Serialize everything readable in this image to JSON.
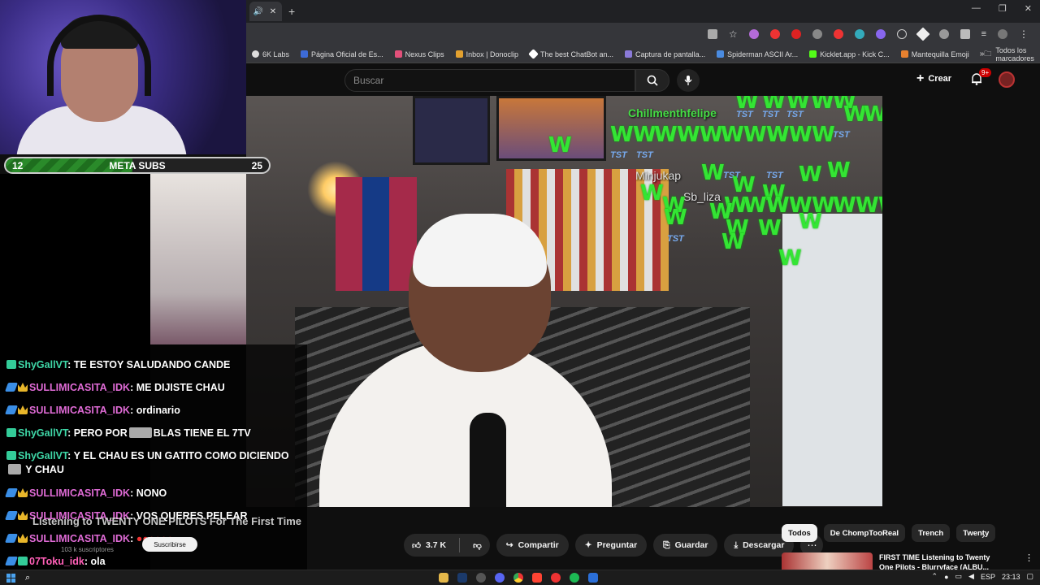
{
  "browser": {
    "tab_mute_icon": "speaker-icon",
    "bookmarks": [
      {
        "label": "6K Labs",
        "color": "#dddddd"
      },
      {
        "label": "Página Oficial de Es...",
        "color": "#3d6bd8"
      },
      {
        "label": "Nexus Clips",
        "color": "#e2507a"
      },
      {
        "label": "Inbox | Donoclip",
        "color": "#e3a12f"
      },
      {
        "label": "The best ChatBot an...",
        "color": "#ffffff"
      },
      {
        "label": "Captura de pantalla...",
        "color": "#8a7ad8"
      },
      {
        "label": "Spiderman ASCII Ar...",
        "color": "#4a8be0"
      },
      {
        "label": "Kicklet.app - Kick C...",
        "color": "#53fc18"
      },
      {
        "label": "Mantequilla Emoji",
        "color": "#e8812f"
      }
    ],
    "bookmarks_more": "»",
    "bookmarks_folder": "Todos los marcadores"
  },
  "youtube": {
    "search_placeholder": "Buscar",
    "create_label": "Crear",
    "notification_badge": "9+",
    "actions": {
      "like_count": "3.7 K",
      "share": "Compartir",
      "ask": "Preguntar",
      "save": "Guardar",
      "download": "Descargar"
    },
    "chips": [
      "Todos",
      "De ChompTooReal",
      "Trench",
      "Twenty"
    ],
    "title_ghost": "Listening to TWENTY ONE PILOTS For The First Time",
    "channel_subs": "103 k suscriptores",
    "subscribe": "Suscribirse",
    "recommendation": {
      "title": "FIRST TIME Listening to Twenty One Pilots - Blurryface (ALBU..."
    }
  },
  "overlay": {
    "users": [
      "Chillmenthfelipe",
      "Minjukap",
      "Sb_liza"
    ],
    "w_text": "W",
    "tst_text": "TST"
  },
  "subgoal": {
    "current": "12",
    "label": "META SUBS",
    "goal": "25",
    "progress": 0.48
  },
  "chat": [
    {
      "user": "ShyGallVT",
      "text": "TE ESTOY SALUDANDO CANDE",
      "badge": "b1",
      "color": "green"
    },
    {
      "user": "SULLIMICASITA_IDK",
      "text": "ME DIJISTE CHAU",
      "badge": "b2",
      "color": "pink"
    },
    {
      "user": "SULLIMICASITA_IDK",
      "text": "ordinario",
      "badge": "b2",
      "color": "pink"
    },
    {
      "user": "ShyGallVT",
      "text": "PERO POR",
      "text2": "BLAS TIENE EL 7TV",
      "badge": "b1",
      "color": "green"
    },
    {
      "user": "ShyGallVT",
      "text": "Y EL CHAU ES UN GATITO COMO DICIENDO",
      "text2": "Y CHAU",
      "badge": "b1",
      "color": "green"
    },
    {
      "user": "SULLIMICASITA_IDK",
      "text": "NONO",
      "badge": "b2",
      "color": "pink"
    },
    {
      "user": "SULLIMICASITA_IDK",
      "text": "VOS QUERES PELEAR",
      "badge": "b2",
      "color": "pink"
    },
    {
      "user": "SULLIMICASITA_IDK",
      "text": "",
      "badge": "b2",
      "color": "pink"
    },
    {
      "user": "07Toku_idk",
      "text": "ola",
      "badge": "b2",
      "color": "pink2"
    }
  ],
  "taskbar": {
    "lang": "ESP",
    "time": "23:13"
  }
}
